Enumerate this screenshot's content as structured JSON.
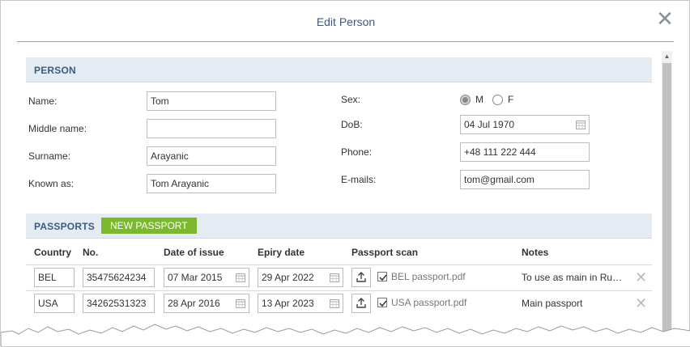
{
  "dialog": {
    "title": "Edit Person",
    "close_icon": "close-icon"
  },
  "person": {
    "section_title": "PERSON",
    "name": {
      "label": "Name:",
      "value": "Tom"
    },
    "middle_name": {
      "label": "Middle name:",
      "value": ""
    },
    "surname": {
      "label": "Surname:",
      "value": "Arayanic"
    },
    "known_as": {
      "label": "Known as:",
      "value": "Tom Arayanic"
    },
    "sex": {
      "label": "Sex:",
      "options": [
        "M",
        "F"
      ],
      "selected": "M"
    },
    "dob": {
      "label": "DoB:",
      "value": "04 Jul 1970"
    },
    "phone": {
      "label": "Phone:",
      "value": "+48 111 222 444"
    },
    "emails": {
      "label": "E-mails:",
      "value": "tom@gmail.com"
    }
  },
  "passports": {
    "section_title": "PASSPORTS",
    "new_button": "NEW PASSPORT",
    "columns": [
      "Country",
      "No.",
      "Date of issue",
      "Epiry date",
      "Passport scan",
      "Notes"
    ],
    "rows": [
      {
        "country": "BEL",
        "number": "35475624234",
        "issue": "07 Mar 2015",
        "expiry": "29 Apr 2022",
        "scan_checked": true,
        "scan_file": "BEL passport.pdf",
        "notes": "To use as main in Russia"
      },
      {
        "country": "USA",
        "number": "34262531323",
        "issue": "28 Apr 2016",
        "expiry": "13 Apr 2023",
        "scan_checked": true,
        "scan_file": "USA passport.pdf",
        "notes": "Main passport"
      }
    ]
  },
  "colors": {
    "accent": "#3d5a80",
    "section_bg": "#e4ebf3",
    "button_green": "#7ab82e"
  }
}
